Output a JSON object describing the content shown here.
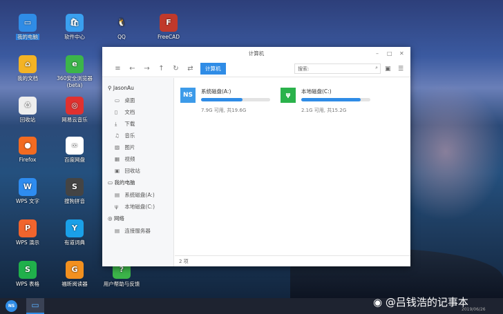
{
  "desktop": {
    "icons": [
      {
        "label": "我的电脑",
        "glyph": "▭",
        "color": "#2f8ce6",
        "selected": true
      },
      {
        "label": "软件中心",
        "glyph": "🛍",
        "color": "#3aa0f0"
      },
      {
        "label": "QQ",
        "glyph": "🐧",
        "color": "transparent"
      },
      {
        "label": "FreeCAD",
        "glyph": "F",
        "color": "#c0392b"
      },
      {
        "label": "我的文档",
        "glyph": "⌂",
        "color": "#f4b324"
      },
      {
        "label": "360安全浏览器 (beta)",
        "glyph": "e",
        "color": "#3cb54a"
      },
      {
        "label": "回收站",
        "glyph": "♻",
        "color": "#eeeeee"
      },
      {
        "label": "网易云音乐",
        "glyph": "◎",
        "color": "#e0312f"
      },
      {
        "label": "Firefox",
        "glyph": "●",
        "color": "#f26b21"
      },
      {
        "label": "百度网盘",
        "glyph": "∞",
        "color": "#ffffff"
      },
      {
        "label": "WPS 文字",
        "glyph": "W",
        "color": "#2e8cf0"
      },
      {
        "label": "搜狗拼音",
        "glyph": "S",
        "color": "#444444"
      },
      {
        "label": "WPS 演示",
        "glyph": "P",
        "color": "#f0642d"
      },
      {
        "label": "有道词典",
        "glyph": "Y",
        "color": "#1aa0e8"
      },
      {
        "label": "WPS 表格",
        "glyph": "S",
        "color": "#20b04b"
      },
      {
        "label": "福昕阅读器",
        "glyph": "G",
        "color": "#f2901f"
      },
      {
        "label": "用户帮助与反馈",
        "glyph": "?",
        "color": "#3cb54a"
      }
    ]
  },
  "window": {
    "title": "计算机",
    "breadcrumb": "计算机",
    "search_placeholder": "搜索:",
    "sidebar": {
      "user": "JasonAu",
      "user_items": [
        "桌面",
        "文档",
        "下载",
        "音乐",
        "图片",
        "视频",
        "回收站"
      ],
      "computer": "我的电脑",
      "computer_items": [
        "系统磁盘(A:)",
        "本地磁盘(C:)"
      ],
      "network": "网络",
      "network_items": [
        "连接服务器"
      ]
    },
    "disks": [
      {
        "name": "系统磁盘(A:)",
        "capacity": "7.9G 可用, 共19.6G",
        "used_fraction": 0.6,
        "icon": "NS",
        "color": "#3d9be9"
      },
      {
        "name": "本地磁盘(C:)",
        "capacity": "2.1G 可用, 共15.2G",
        "used_fraction": 0.86,
        "icon": "ψ",
        "color": "#2ab24b"
      }
    ],
    "status": "2 项"
  },
  "watermark": {
    "text": "@吕钱浩的记事本",
    "date": "2019/06/26"
  },
  "taskbar": {
    "start": "NS"
  }
}
